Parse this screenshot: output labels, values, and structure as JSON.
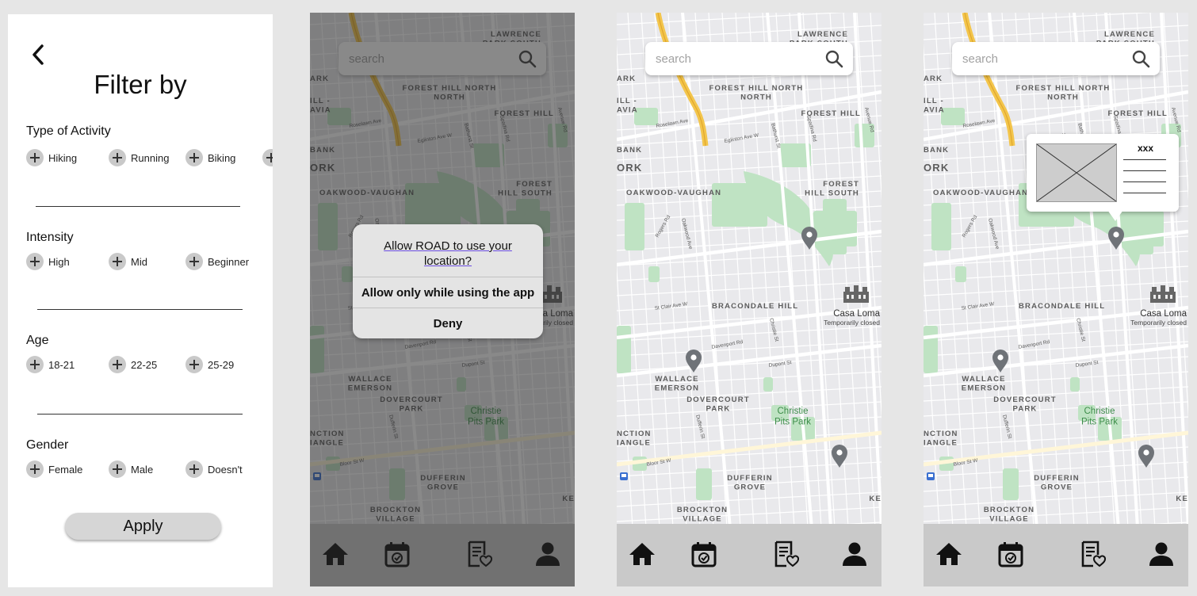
{
  "filter": {
    "title": "Filter by",
    "sections": [
      {
        "title": "Type of Activity",
        "options": [
          "Hiking",
          "Running",
          "Biking"
        ]
      },
      {
        "title": "Intensity",
        "options": [
          "High",
          "Mid",
          "Beginner"
        ]
      },
      {
        "title": "Age",
        "options": [
          "18-21",
          "22-25",
          "25-29"
        ]
      },
      {
        "title": "Gender",
        "options": [
          "Female",
          "Male",
          "Doesn't"
        ]
      }
    ],
    "apply_label": "Apply"
  },
  "search": {
    "placeholder": "search"
  },
  "map_labels": {
    "lawrence_park_south": "LAWRENCE PARK SOUTH",
    "forest_hill_north": "FOREST HILL NORTH",
    "forest_hill": "FOREST HILL",
    "forest_hill_south": "FOREST HILL SOUTH",
    "oakwood_vaughan": "OAKWOOD-VAUGHAN",
    "braconale_hill": "BRACONDALE HILL",
    "wallace_emerson": "WALLACE EMERSON",
    "dovercourt_park": "DOVERCOURT PARK",
    "christie_pits_park": "Christie Pits Park",
    "dufferin_grove": "DUFFERIN GROVE",
    "brockton_village": "BROCKTON VILLAGE",
    "junction_triangle": "NCTION IANGLE",
    "casa_loma": "Casa Loma",
    "casa_loma_status": "Temporarily closed",
    "park": "ARK",
    "hill_avia": "ILL - AVIA",
    "bank": "BANK",
    "york": "ORK",
    "st_clair_ave_w": "St Clair Ave W",
    "eglinton_ave_w": "Eglinton Ave W",
    "davenport_rd": "Davenport Rd",
    "dupont_st": "Dupont St",
    "bloor_st_w": "Bloor St W",
    "rosedale": "Roselawn Ave",
    "bathurst_st": "Bathurst St",
    "christie_st": "Christie St",
    "dufferin_st": "Dufferin St",
    "oakwood_ave": "Oakwood Ave",
    "rogers_rd": "Rogers Rd",
    "spadina_rd": "Spadina Rd",
    "avenue_rd": "Avenue Rd",
    "ke": "KE"
  },
  "dialog": {
    "message": "Allow ROAD to use your location?",
    "allow_label": "Allow only while using the app",
    "deny_label": "Deny"
  },
  "popup": {
    "title": "xxx"
  },
  "nav": [
    "home-icon",
    "calendar-check-icon",
    "saved-list-icon",
    "profile-icon"
  ],
  "colors": {
    "map_bg": "#e9e9ec",
    "park": "#bfe3c3",
    "highway": "#f3c54b",
    "navbar": "#c9c9c9",
    "pin": "#6f7378",
    "dialog_underline": "#6a4ce0"
  }
}
